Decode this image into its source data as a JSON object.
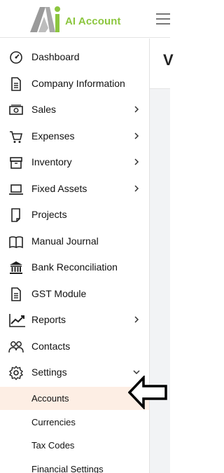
{
  "header": {
    "brand": "AI Account",
    "logo_icon": "ai-account-logo",
    "menu_icon": "hamburger-icon"
  },
  "main": {
    "title_partial": "V"
  },
  "sidebar": {
    "items": [
      {
        "label": "Dashboard",
        "icon": "dashboard-icon",
        "has_children": false
      },
      {
        "label": "Company Information",
        "icon": "document-icon",
        "has_children": false
      },
      {
        "label": "Sales",
        "icon": "cash-icon",
        "has_children": true
      },
      {
        "label": "Expenses",
        "icon": "cart-icon",
        "has_children": true
      },
      {
        "label": "Inventory",
        "icon": "archive-icon",
        "has_children": true
      },
      {
        "label": "Fixed Assets",
        "icon": "laptop-icon",
        "has_children": true
      },
      {
        "label": "Projects",
        "icon": "file-icon",
        "has_children": false
      },
      {
        "label": "Manual Journal",
        "icon": "book-icon",
        "has_children": false
      },
      {
        "label": "Bank Reconciliation",
        "icon": "bank-icon",
        "has_children": false
      },
      {
        "label": "GST Module",
        "icon": "document-icon",
        "has_children": false
      },
      {
        "label": "Reports",
        "icon": "chart-line-icon",
        "has_children": true
      },
      {
        "label": "Contacts",
        "icon": "people-icon",
        "has_children": false
      },
      {
        "label": "Settings",
        "icon": "gear-icon",
        "has_children": true,
        "expanded": true
      }
    ],
    "settings_children": [
      {
        "label": "Accounts",
        "active": true
      },
      {
        "label": "Currencies",
        "active": false
      },
      {
        "label": "Tax Codes",
        "active": false
      },
      {
        "label": "Financial Settings",
        "active": false
      }
    ]
  },
  "colors": {
    "brand_green": "#8cc63f",
    "active_bg": "#fdeee4",
    "text": "#111111"
  },
  "annotation": {
    "icon": "left-arrow-pointer-icon"
  }
}
